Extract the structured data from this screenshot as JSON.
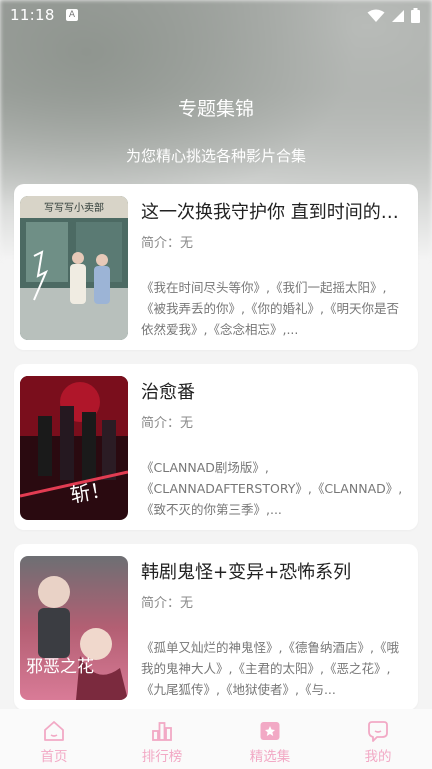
{
  "status_bar": {
    "time": "11:18",
    "notice_letter": "A"
  },
  "header": {
    "title": "专题集锦",
    "subtitle": "为您精心挑选各种影片合集"
  },
  "collections": [
    {
      "title": "这一次换我守护你 直到时间的尽头",
      "intro": "简介：无",
      "desc": "《我在时间尽头等你》,《我们一起摇太阳》,《被我弄丢的你》,《你的婚礼》,《明天你是否依然爱我》,《念念相忘》,...",
      "poster_text": "",
      "poster_sign": "写写写小卖部"
    },
    {
      "title": "治愈番",
      "intro": "简介：无",
      "desc": "《CLANNAD剧场版》,《CLANNADAFTERSTORY》,《CLANNAD》,《致不灭的你第三季》,...",
      "poster_text": "斩！"
    },
    {
      "title": "韩剧鬼怪+变异+恐怖系列",
      "intro": "简介：无",
      "desc": "《孤单又灿烂的神鬼怪》,《德鲁纳酒店》,《哦我的鬼神大人》,《主君的太阳》,《恶之花》,《九尾狐传》,《地狱使者》,《与...",
      "poster_text": "邪恶之花"
    }
  ],
  "tabs": [
    {
      "label": "首页",
      "icon": "home-icon"
    },
    {
      "label": "排行榜",
      "icon": "chart-icon"
    },
    {
      "label": "精选集",
      "icon": "star-box-icon"
    },
    {
      "label": "我的",
      "icon": "user-icon"
    }
  ],
  "colors": {
    "accent": "#f2a9c5",
    "card_bg": "#ffffff",
    "page_bg": "#f4f4f4"
  }
}
